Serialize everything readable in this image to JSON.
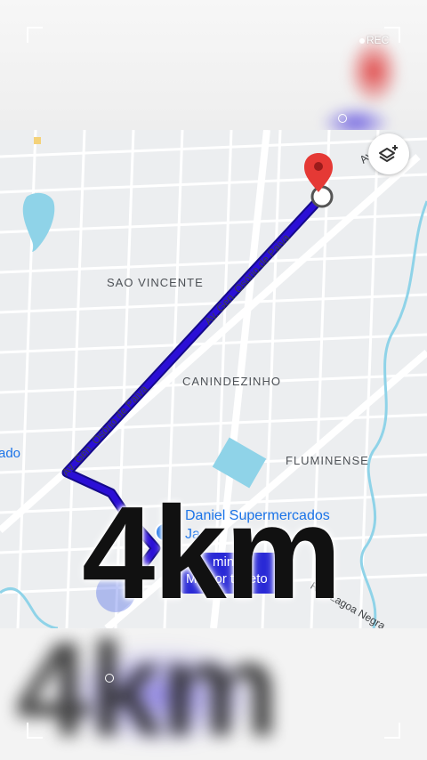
{
  "camera_overlay": {
    "rec_label": "REC"
  },
  "map": {
    "area_labels": {
      "sao_vicente": "SAO VINCENTE",
      "canindezinho": "CANINDEZINHO",
      "fluminense": "FLUMINENSE",
      "partial_left": "ado"
    },
    "street_labels": {
      "av_upper": "Av. Gen. Osório de Paiva",
      "av_lower": "Av. Gen. Osório de Paiva",
      "rua": "Rua Lagoa Negra",
      "av_top_right": "Av"
    },
    "poi": {
      "name_line1": "Daniel Supermercados",
      "name_line2": "Ja"
    },
    "route_card": {
      "time": "min",
      "subtitle": "Melhor trajeto"
    },
    "overlay_text": "4km",
    "colors": {
      "route": "#2b0fd6",
      "route_outline": "#150a8a",
      "destination_pin": "#e53935",
      "water": "#8fd3e8"
    }
  }
}
